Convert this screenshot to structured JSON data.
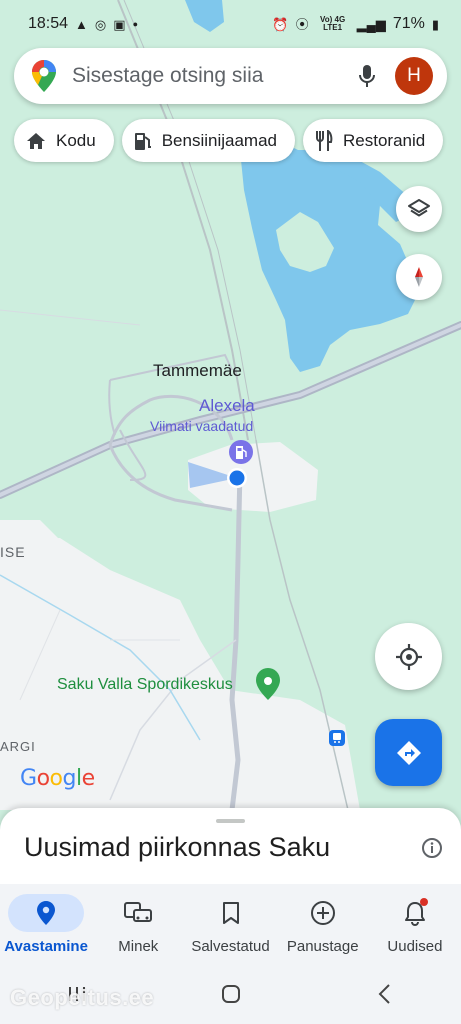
{
  "status_bar": {
    "time": "18:54",
    "network": "Vo) 4G LTE1",
    "battery": "71%"
  },
  "search": {
    "placeholder": "Sisestage otsing siia",
    "avatar_letter": "H"
  },
  "chips": [
    {
      "label": "Kodu",
      "icon": "home-icon"
    },
    {
      "label": "Bensiinijaamad",
      "icon": "gas-station-icon"
    },
    {
      "label": "Restoranid",
      "icon": "restaurant-icon"
    }
  ],
  "map": {
    "town_label": "Tammemäe",
    "poi_name": "Alexela",
    "poi_sublabel": "Viimati vaadatud",
    "area_label_1": "ISE",
    "sport_label": "Saku Valla Spordikeskus",
    "area_label_2": "ARGI",
    "google_logo": "Google",
    "colors": {
      "land": "#cdeede",
      "water": "#7fc7ec",
      "urban": "#f1f3f4",
      "road": "#aeb6c6",
      "poi_purple": "#5e5ad3",
      "location_blue": "#1a73e8"
    }
  },
  "sheet": {
    "title": "Uusimad piirkonnas Saku"
  },
  "bottom_nav": [
    {
      "label": "Avastamine",
      "icon": "explore-pin-icon",
      "active": true
    },
    {
      "label": "Minek",
      "icon": "commute-icon"
    },
    {
      "label": "Salvestatud",
      "icon": "bookmark-icon"
    },
    {
      "label": "Panustage",
      "icon": "add-circle-icon"
    },
    {
      "label": "Uudised",
      "icon": "bell-icon",
      "badge": true
    }
  ],
  "watermark": "Geopeitus.ee"
}
